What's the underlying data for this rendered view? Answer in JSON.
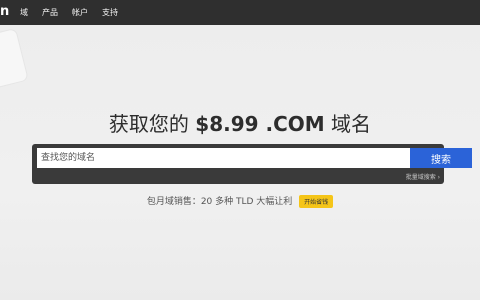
{
  "header": {
    "logo_text": "n",
    "nav": [
      {
        "label": "域"
      },
      {
        "label": "产品"
      },
      {
        "label": "帐户"
      },
      {
        "label": "支持"
      }
    ]
  },
  "hero": {
    "title_prefix": "获取您的 ",
    "title_price": "$8.99",
    "title_tld": " .COM",
    "title_suffix": " 域名"
  },
  "search": {
    "placeholder": "查找您的域名",
    "value": "",
    "button_label": "搜索",
    "bulk_link": "批量域搜索 ›"
  },
  "promo": {
    "text": "包月域销售：20 多种 TLD 大幅让利",
    "button_label": "开始省钱"
  },
  "colors": {
    "topbar": "#2f2f2f",
    "search_frame": "#3a3a3a",
    "search_button": "#2b63d8",
    "promo_button": "#f5c518"
  }
}
